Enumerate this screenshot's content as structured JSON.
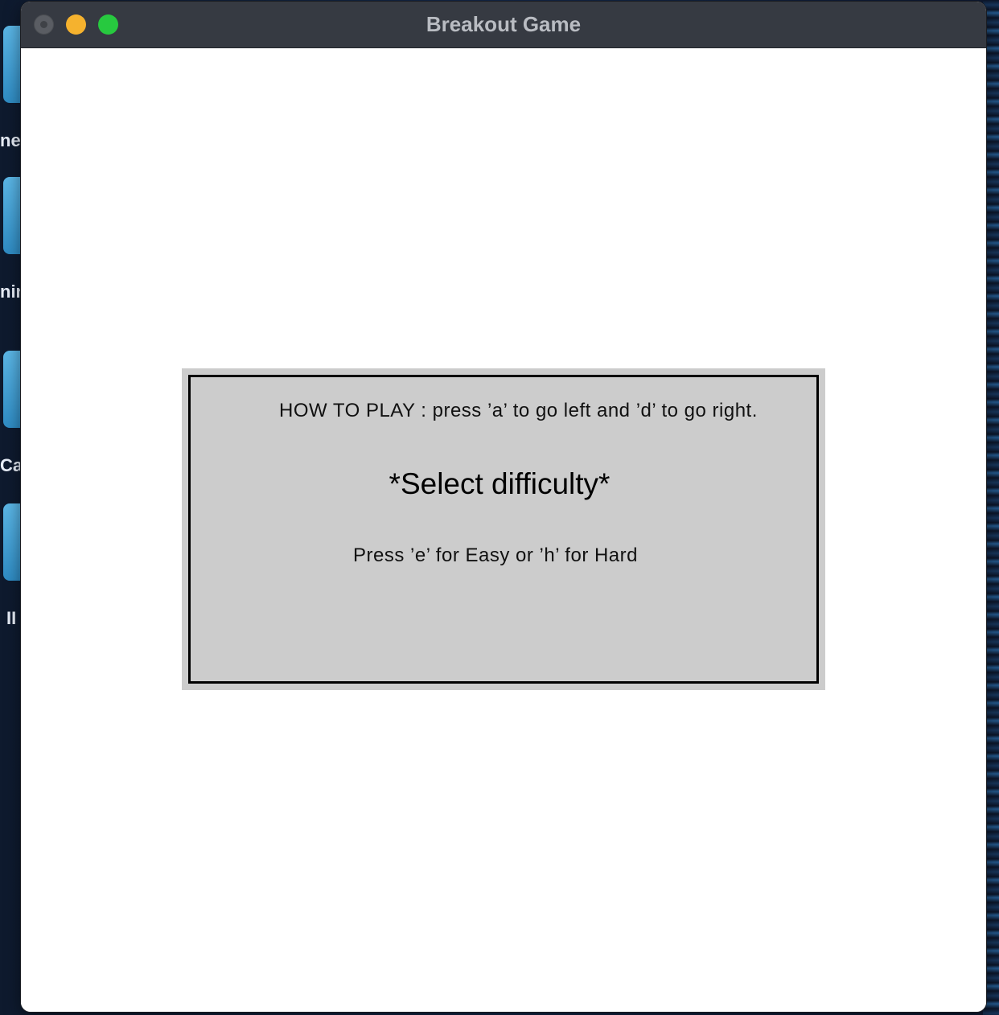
{
  "window": {
    "title": "Breakout Game"
  },
  "desktop": {
    "labels": [
      "nes",
      "nin",
      "Ca",
      "II"
    ]
  },
  "dialog": {
    "instructions": "HOW TO PLAY : press ’a’ to go left and ’d’ to go right.",
    "heading": "*Select difficulty*",
    "hint": "Press ’e’ for Easy or ’h’ for Hard"
  }
}
